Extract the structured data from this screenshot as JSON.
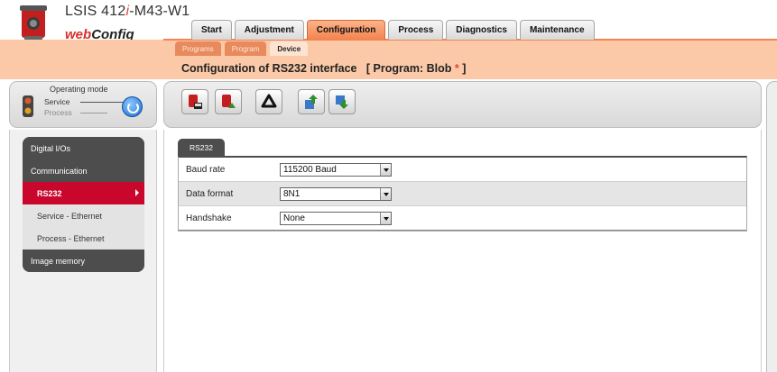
{
  "header": {
    "product_prefix": "LSIS 412",
    "product_i": "i",
    "product_suffix": "-M43-W1",
    "brand_web": "web",
    "brand_config": "Config"
  },
  "main_tabs": [
    "Start",
    "Adjustment",
    "Configuration",
    "Process",
    "Diagnostics",
    "Maintenance"
  ],
  "active_main_tab": "Configuration",
  "sub_tabs": [
    "Programs",
    "Program",
    "Device"
  ],
  "active_sub_tab": "Device",
  "page_title": {
    "text": "Configuration of RS232 interface",
    "program_prefix": "[ Program: Blob",
    "star": "*",
    "close": "]"
  },
  "operating_mode": {
    "title": "Operating mode",
    "service": "Service",
    "process": "Process"
  },
  "nav": {
    "digital_ios": "Digital I/Os",
    "communication": "Communication",
    "rs232": "RS232",
    "service_ethernet": "Service - Ethernet",
    "process_ethernet": "Process - Ethernet",
    "image_memory": "Image memory"
  },
  "toolbar": {
    "icons": [
      "device-red-icon",
      "device-green-icon",
      "recycle-icon",
      "upload-icon",
      "download-icon"
    ]
  },
  "content": {
    "tab": "RS232",
    "rows": [
      {
        "label": "Baud rate",
        "value": "115200 Baud"
      },
      {
        "label": "Data format",
        "value": "8N1"
      },
      {
        "label": "Handshake",
        "value": "None"
      }
    ]
  },
  "colors": {
    "accent_orange": "#f3834f",
    "band_orange": "#fbc9a7",
    "active_nav": "#c9072c",
    "dark_nav": "#4d4d4d"
  }
}
